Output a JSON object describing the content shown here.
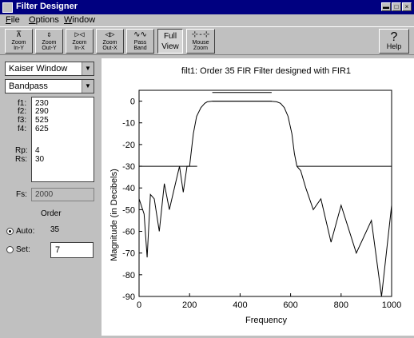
{
  "window": {
    "title": "Filter Designer",
    "minimize": "▬",
    "maximize": "□",
    "close": "×"
  },
  "menu": [
    {
      "first": "F",
      "rest": "ile"
    },
    {
      "first": "O",
      "rest": "ptions"
    },
    {
      "first": "W",
      "rest": "indow"
    }
  ],
  "toolbar": {
    "zoom_in_y": [
      "Zoom",
      "In-Y"
    ],
    "zoom_out_y": [
      "Zoom",
      "Out-Y"
    ],
    "zoom_in_x": [
      "Zoom",
      "In-X"
    ],
    "zoom_out_x": [
      "Zoom",
      "Out-X"
    ],
    "pass_band": [
      "Pass",
      "Band"
    ],
    "full_view": [
      "Full",
      "View"
    ],
    "mouse_zoom": [
      "Mouse",
      "Zoom"
    ],
    "help": "Help",
    "help_glyph": "?"
  },
  "panel": {
    "window_type": "Kaiser Window",
    "band_type": "Bandpass",
    "specs": [
      {
        "label": "f1:",
        "value": "230"
      },
      {
        "label": "f2:",
        "value": "290"
      },
      {
        "label": "f3:",
        "value": "525"
      },
      {
        "label": "f4:",
        "value": "625"
      },
      {
        "label": "Rp:",
        "value": "4"
      },
      {
        "label": "Rs:",
        "value": "30"
      }
    ],
    "fs_label": "Fs:",
    "fs_value": "2000",
    "order_label": "Order",
    "auto_label": "Auto:",
    "auto_value": "35",
    "auto_selected": true,
    "set_label": "Set:",
    "set_value": "7"
  },
  "chart_data": {
    "type": "line",
    "title": "filt1:  Order 35 FIR Filter designed with FIR1",
    "xlabel": "Frequency",
    "ylabel": "Magnitude (in Decibels)",
    "xlim": [
      0,
      1000
    ],
    "ylim": [
      -90,
      5
    ],
    "xticks": [
      0,
      200,
      400,
      600,
      800,
      1000
    ],
    "yticks": [
      0,
      -10,
      -20,
      -30,
      -40,
      -50,
      -60,
      -70,
      -80,
      -90
    ],
    "grid": false,
    "series": [
      {
        "x": [
          0,
          20,
          32,
          45,
          60,
          80,
          100,
          120,
          140,
          160,
          175,
          190,
          200,
          215,
          228,
          245,
          260,
          270,
          290,
          320,
          360,
          400,
          440,
          480,
          520,
          545,
          560,
          575,
          590,
          605,
          615,
          625,
          640,
          660,
          690,
          720,
          760,
          800,
          860,
          920,
          960,
          1000
        ],
        "y": [
          -45,
          -52,
          -72,
          -43,
          -45,
          -60,
          -38,
          -50,
          -40,
          -30,
          -42,
          -30,
          -30,
          -15,
          -7,
          -3,
          -1,
          -0.3,
          0,
          0,
          0,
          0,
          0,
          0,
          0,
          -0.3,
          -1,
          -3,
          -7,
          -15,
          -24,
          -30,
          -32,
          -40,
          -50,
          -45,
          -65,
          -48,
          -70,
          -55,
          -90,
          -48
        ]
      },
      {
        "x": [
          0,
          230
        ],
        "y": [
          -30,
          -30
        ]
      },
      {
        "x": [
          625,
          1000
        ],
        "y": [
          -30,
          -30
        ]
      },
      {
        "x": [
          290,
          525
        ],
        "y": [
          4,
          4
        ]
      },
      {
        "x": [
          290,
          525
        ],
        "y": [
          0,
          0
        ]
      }
    ]
  }
}
